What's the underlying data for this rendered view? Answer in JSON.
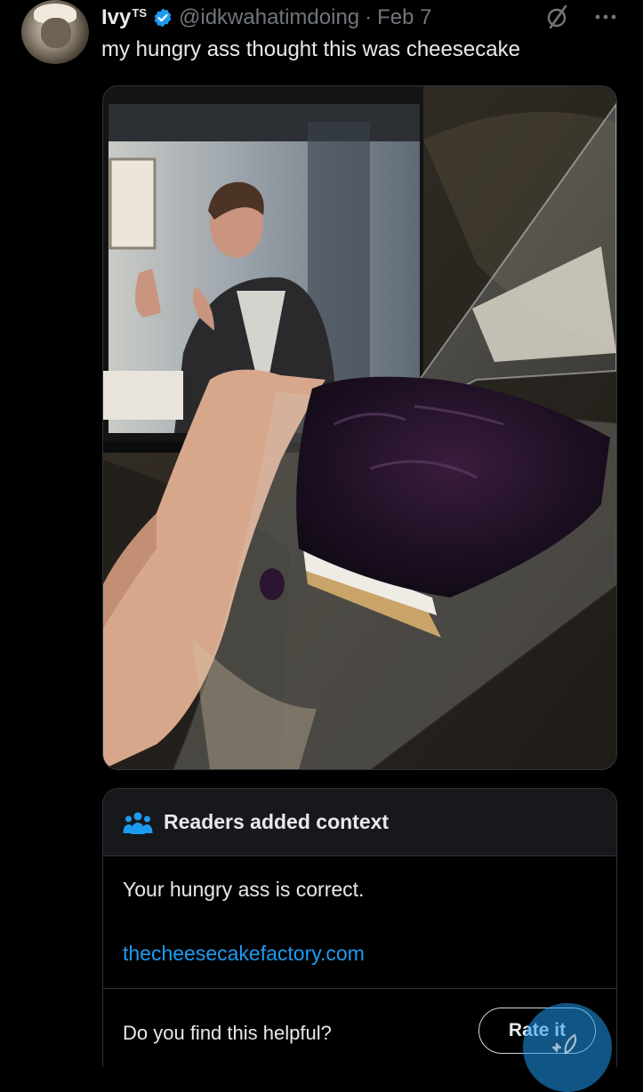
{
  "tweet": {
    "display_name": "Ivy",
    "name_suffix": "TS",
    "handle": "@idkwahatimdoing",
    "separator": "·",
    "date": "Feb 7",
    "text": "my hungry ass thought this was cheesecake"
  },
  "media": {
    "image": "photo of a blueberry-topped dessert in a plastic clamshell container held in front of a tablet showing a TV scene"
  },
  "note": {
    "title": "Readers added context",
    "body": "Your hungry ass is correct.",
    "link": "thecheesecakefactory.com",
    "question": "Do you find this helpful?",
    "rate_label": "Rate it"
  },
  "colors": {
    "background": "#000000",
    "text": "#e7e9ea",
    "muted": "#71767b",
    "accent": "#1d9bf0",
    "note_header_bg": "#16181c",
    "border": "#2f3336"
  },
  "icons": [
    "verified-badge-icon",
    "grok-slash-icon",
    "more-icon",
    "people-icon",
    "compose-icon"
  ]
}
